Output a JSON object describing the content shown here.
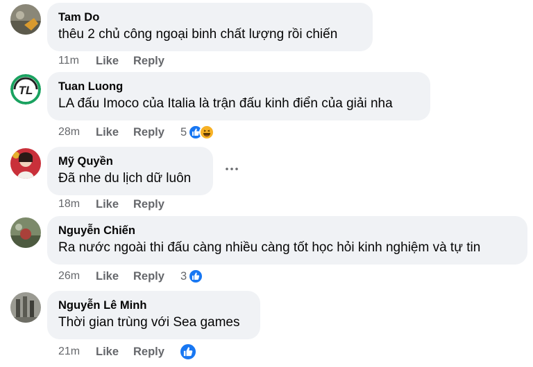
{
  "comments": [
    {
      "author": "Tam Do",
      "text": "thêu 2 chủ công ngoại binh chất lượng rồi chiến",
      "time": "11m",
      "like": "Like",
      "reply": "Reply",
      "reactions": ""
    },
    {
      "author": "Tuan Luong",
      "text": "LA đấu Imoco của Italia là trận đấu kinh điển của giải nha",
      "time": "28m",
      "like": "Like",
      "reply": "Reply",
      "reactions": "5"
    },
    {
      "author": "Mỹ Quyền",
      "text": "Đã nhe du lịch dữ luôn",
      "time": "18m",
      "like": "Like",
      "reply": "Reply",
      "reactions": ""
    },
    {
      "author": "Nguyễn Chiến",
      "text": "Ra nước ngoài thi đấu càng nhiều càng tốt học hỏi kinh nghiệm và tự tin",
      "time": "26m",
      "like": "Like",
      "reply": "Reply",
      "reactions": "3"
    },
    {
      "author": "Nguyễn Lê Minh",
      "text": "Thời gian trùng với Sea games",
      "time": "21m",
      "like": "Like",
      "reply": "Reply",
      "reactions": ""
    }
  ],
  "avatar_logo_text": "TL",
  "colors": {
    "bubble": "#f0f2f5",
    "like_blue": "#1877f2",
    "haha_yellow": "#f7b125",
    "secondary_text": "#65676b",
    "logo_green": "#1aa260"
  },
  "icons": {
    "more": "more-horizontal-icon",
    "like_reaction": "like-reaction-icon",
    "haha_reaction": "haha-reaction-icon"
  }
}
